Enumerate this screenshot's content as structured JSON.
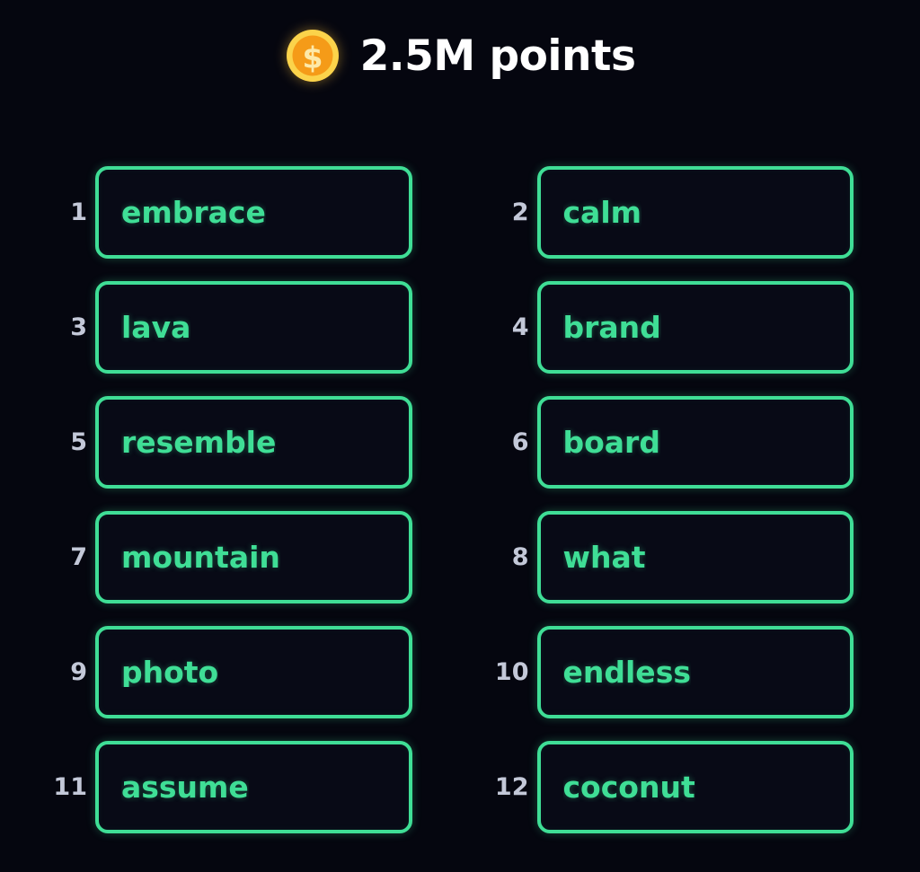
{
  "header": {
    "coin_icon": "coin-dollar-icon",
    "points_text": "2.5M points",
    "coin_outer_color": "#fbd34b",
    "coin_inner_color": "#f59b18",
    "coin_symbol": "$",
    "text_color": "#ffffff"
  },
  "theme": {
    "background": "#05060f",
    "card_background": "#080a16",
    "accent_green": "#3fde96",
    "index_color": "#c3c8d8"
  },
  "word_list": {
    "count": 12,
    "items": [
      {
        "index": "1",
        "word": "embrace"
      },
      {
        "index": "2",
        "word": "calm"
      },
      {
        "index": "3",
        "word": "lava"
      },
      {
        "index": "4",
        "word": "brand"
      },
      {
        "index": "5",
        "word": "resemble"
      },
      {
        "index": "6",
        "word": "board"
      },
      {
        "index": "7",
        "word": "mountain"
      },
      {
        "index": "8",
        "what_placeholder": "",
        "word": "what"
      },
      {
        "index": "9",
        "word": "photo"
      },
      {
        "index": "10",
        "word": "endless"
      },
      {
        "index": "11",
        "word": "assume"
      },
      {
        "index": "12",
        "word": "coconut"
      }
    ]
  }
}
